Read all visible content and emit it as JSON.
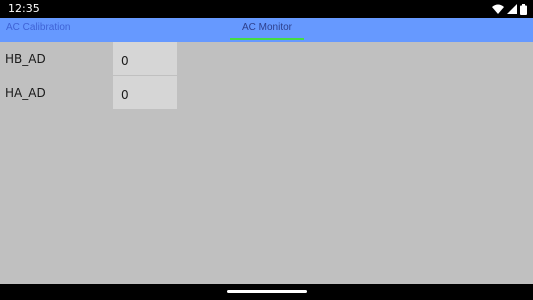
{
  "status_bar": {
    "time": "12:35",
    "icons": [
      "wifi-icon",
      "signal-icon",
      "battery-icon"
    ]
  },
  "tabs": [
    {
      "label": "AC Calibration",
      "selected": false
    },
    {
      "label": "AC Monitor",
      "selected": true
    }
  ],
  "fields": [
    {
      "label": "HB_AD",
      "value": "0"
    },
    {
      "label": "HA_AD",
      "value": "0"
    }
  ],
  "colors": {
    "tab_bar_bg": "#6699ff",
    "tab_indicator": "#44dd44",
    "content_bg": "#c0c0c0",
    "field_bg": "#d6d6d6"
  }
}
